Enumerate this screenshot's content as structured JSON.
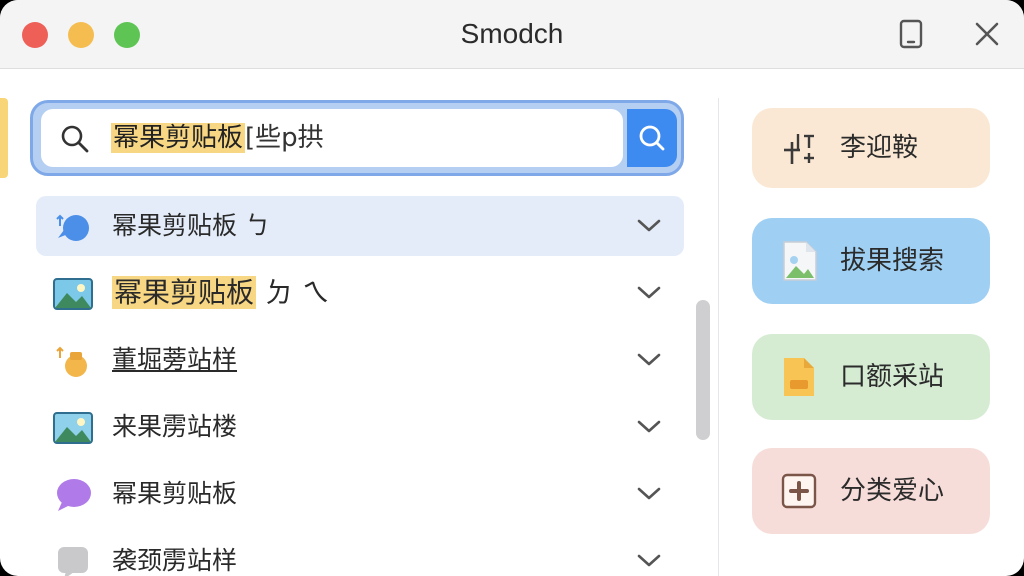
{
  "window": {
    "title": "Smodch"
  },
  "titlebar_icons": [
    "tablet-icon",
    "close-icon"
  ],
  "search": {
    "highlighted_text": "幂果剪贴板",
    "rest_text": "[些p拱",
    "icon": "search-icon",
    "button_icon": "search-icon"
  },
  "results": [
    {
      "label": "幂果剪贴板 ㄅ",
      "icon": "chat-bubble-icon",
      "selected": true
    },
    {
      "label": "幂果剪贴板",
      "suffix": "ㄉ ㄟ",
      "icon": "image-icon",
      "highlighted": true
    },
    {
      "label": "董堀蒡站样",
      "icon": "bag-icon"
    },
    {
      "label": "来果雳站楼",
      "icon": "image-icon"
    },
    {
      "label": "幂果剪贴板",
      "icon": "purple-chat-icon"
    },
    {
      "label": "袭颈雳站样",
      "icon": "grey-chat-icon"
    }
  ],
  "side_buttons": [
    {
      "label": "李迎鞍",
      "icon": "text-plus-icon",
      "color": "#fbe8d4"
    },
    {
      "label": "拔果搜索",
      "icon": "image-file-icon",
      "color": "#9fd0f3"
    },
    {
      "label": "口额采站",
      "icon": "folder-file-icon",
      "color": "#d5ecd3"
    },
    {
      "label": "分类爱心",
      "icon": "plus-square-icon",
      "color": "#f7ddd9"
    }
  ],
  "colors": {
    "accent_blue": "#3d8af0",
    "highlight_yellow": "#f7d684",
    "selected_row": "#e4ecf9"
  }
}
